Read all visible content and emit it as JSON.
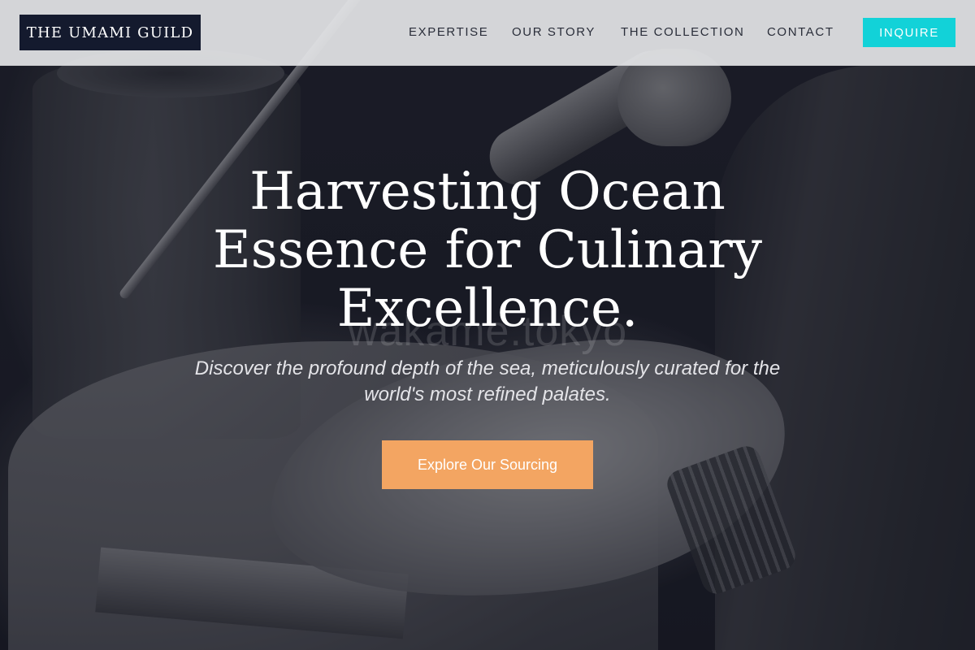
{
  "brand": {
    "name": "THE UMAMI GUILD"
  },
  "nav": {
    "items": [
      {
        "label": "EXPERTISE"
      },
      {
        "label": "OUR STORY"
      },
      {
        "label": "THE COLLECTION"
      },
      {
        "label": "CONTACT"
      }
    ],
    "cta_label": "INQUIRE"
  },
  "hero": {
    "headline": "Harvesting Ocean Essence for Culinary Excellence.",
    "subtitle": "Discover the profound depth of the sea, meticulously curated for the world's most refined palates.",
    "cta_label": "Explore Our Sourcing",
    "watermark": "wakame.tokyo",
    "background_image": "black-and-white craftsman carving wood with chisel"
  },
  "colors": {
    "logo_bg": "#141a2e",
    "inquire_bg": "#12d2d8",
    "cta_bg": "#f3a562",
    "header_bg": "#e4e5e7",
    "nav_text": "#2a2e3a"
  }
}
